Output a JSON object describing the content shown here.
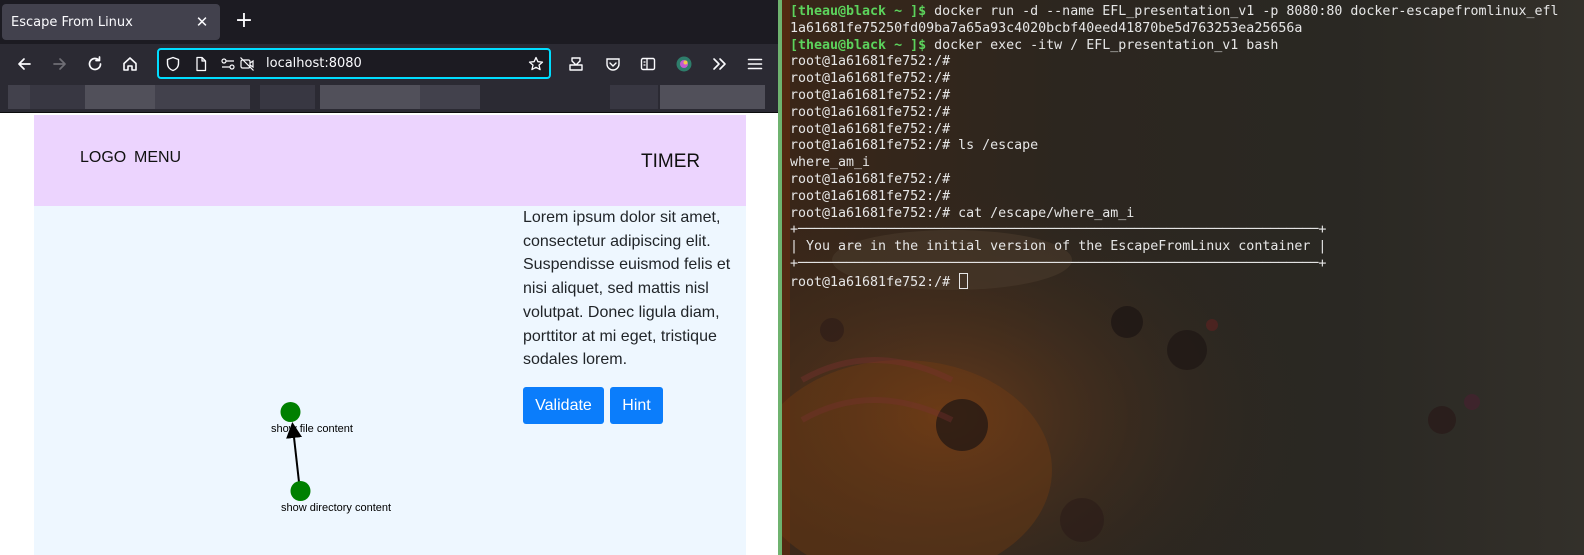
{
  "browser": {
    "tab_title": "Escape From Linux",
    "tab_close": "✕",
    "new_tab": "+",
    "url": "localhost:8080"
  },
  "site": {
    "logo": "LOGO",
    "menu": "MENU",
    "timer": "TIMER",
    "lorem": "Lorem ipsum dolor sit amet, consectetur adipiscing elit. Suspendisse euismod felis et nisi aliquet, sed mattis nisl volutpat. Donec ligula diam, porttitor at mi eget, tristique sodales lorem.",
    "validate_label": "Validate",
    "hint_label": "Hint",
    "graph": {
      "node_top_label": "show file content",
      "node_bottom_label": "show directory content",
      "node_color": "#008000"
    }
  },
  "terminal": {
    "lines": [
      {
        "prompt": "[theau@black ~ ]$",
        "text": " docker run -d --name EFL_presentation_v1 -p 8080:80 docker-escapefromlinux_efl"
      },
      {
        "prompt": "",
        "text": "1a61681fe75250fd09ba7a65a93c4020bcbf40eed41870be5d763253ea25656a"
      },
      {
        "prompt": "[theau@black ~ ]$",
        "text": " docker exec -itw / EFL_presentation_v1 bash"
      },
      {
        "prompt": "",
        "text": "root@1a61681fe752:/#"
      },
      {
        "prompt": "",
        "text": "root@1a61681fe752:/#"
      },
      {
        "prompt": "",
        "text": "root@1a61681fe752:/#"
      },
      {
        "prompt": "",
        "text": "root@1a61681fe752:/#"
      },
      {
        "prompt": "",
        "text": "root@1a61681fe752:/#"
      },
      {
        "prompt": "",
        "text": "root@1a61681fe752:/# ls /escape"
      },
      {
        "prompt": "",
        "text": "where_am_i"
      },
      {
        "prompt": "",
        "text": "root@1a61681fe752:/#"
      },
      {
        "prompt": "",
        "text": "root@1a61681fe752:/#"
      },
      {
        "prompt": "",
        "text": "root@1a61681fe752:/# cat /escape/where_am_i"
      },
      {
        "prompt": "",
        "text": "+─────────────────────────────────────────────────────────────────+"
      },
      {
        "prompt": "",
        "text": "| You are in the initial version of the EscapeFromLinux container |"
      },
      {
        "prompt": "",
        "text": "+─────────────────────────────────────────────────────────────────+"
      },
      {
        "prompt": "",
        "text": "root@1a61681fe752:/# "
      }
    ],
    "prompt_color": "#5cd35c",
    "text_color": "#e6e6e6"
  },
  "colors": {
    "header_bg": "#ecd4fe",
    "main_bg": "#eef7ff",
    "button_bg": "#0b7dfb",
    "url_focus": "#00ddff"
  }
}
